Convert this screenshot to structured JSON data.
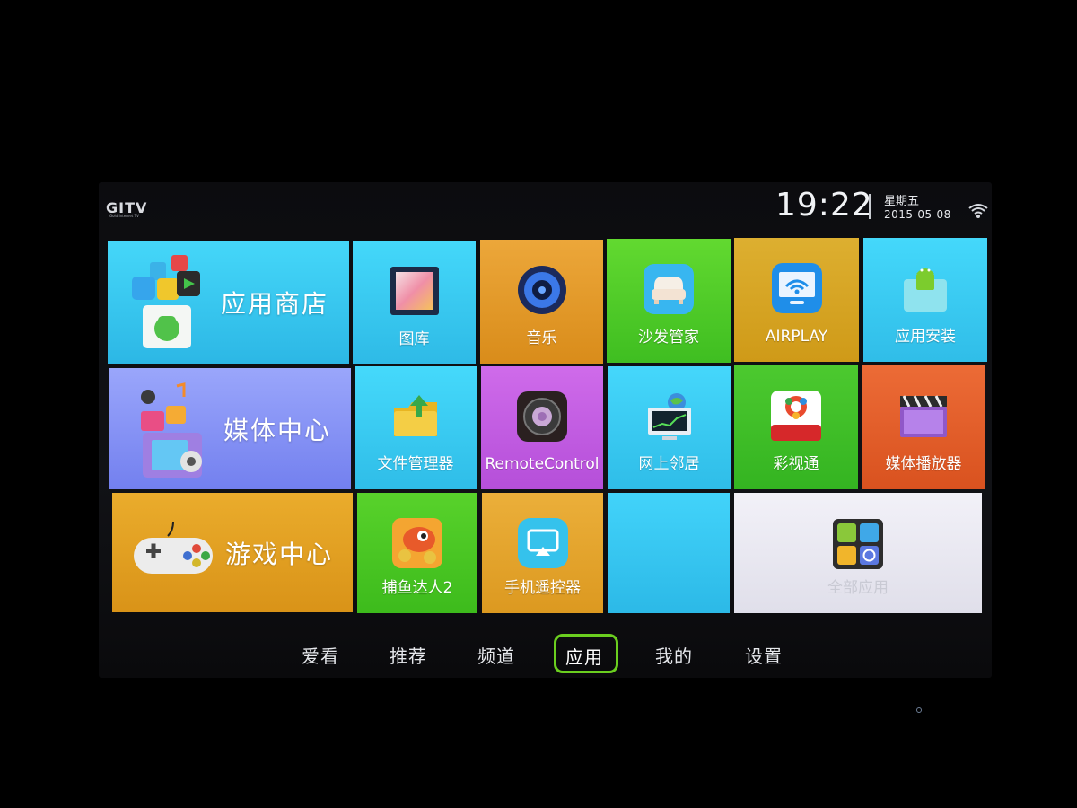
{
  "header": {
    "logo": "GITV",
    "logo_sub": "Gold Internet TV",
    "time": "19:22",
    "weekday": "星期五",
    "date": "2015-05-08",
    "wifi_icon": "wifi-icon"
  },
  "tiles": {
    "app_store": {
      "label": "应用商店",
      "color": "#34c8ee"
    },
    "gallery": {
      "label": "图库",
      "color": "#33c6ea"
    },
    "music": {
      "label": "音乐",
      "color": "#e29b2a"
    },
    "sofa_manager": {
      "label": "沙发管家",
      "color": "#4fcb2b"
    },
    "airplay": {
      "label": "AIRPLAY",
      "color": "#d6a322"
    },
    "app_install": {
      "label": "应用安装",
      "color": "#33c6ee"
    },
    "media_center": {
      "label": "媒体中心",
      "color": "#7f8cf2"
    },
    "file_manager": {
      "label": "文件管理器",
      "color": "#34c7ea"
    },
    "remote_control": {
      "label": "RemoteControl",
      "color": "#c15ae0"
    },
    "network_neighborhood": {
      "label": "网上邻居",
      "color": "#33c6ee"
    },
    "lottery": {
      "label": "彩视通",
      "color": "#42c22b"
    },
    "media_player": {
      "label": "媒体播放器",
      "color": "#e3602c"
    },
    "game_center": {
      "label": "游戏中心",
      "color": "#e3a21f"
    },
    "fishing": {
      "label": "捕鱼达人2",
      "color": "#48c722"
    },
    "phone_remote": {
      "label": "手机遥控器",
      "color": "#e3a527"
    },
    "blank": {
      "label": "",
      "color": "#31c4ee"
    },
    "all_apps": {
      "label": "全部应用",
      "color": "#eaeaf2"
    }
  },
  "nav": {
    "items": [
      "爱看",
      "推荐",
      "频道",
      "应用",
      "我的",
      "设置"
    ],
    "active": "应用",
    "active_color": "#6bcf1f"
  }
}
